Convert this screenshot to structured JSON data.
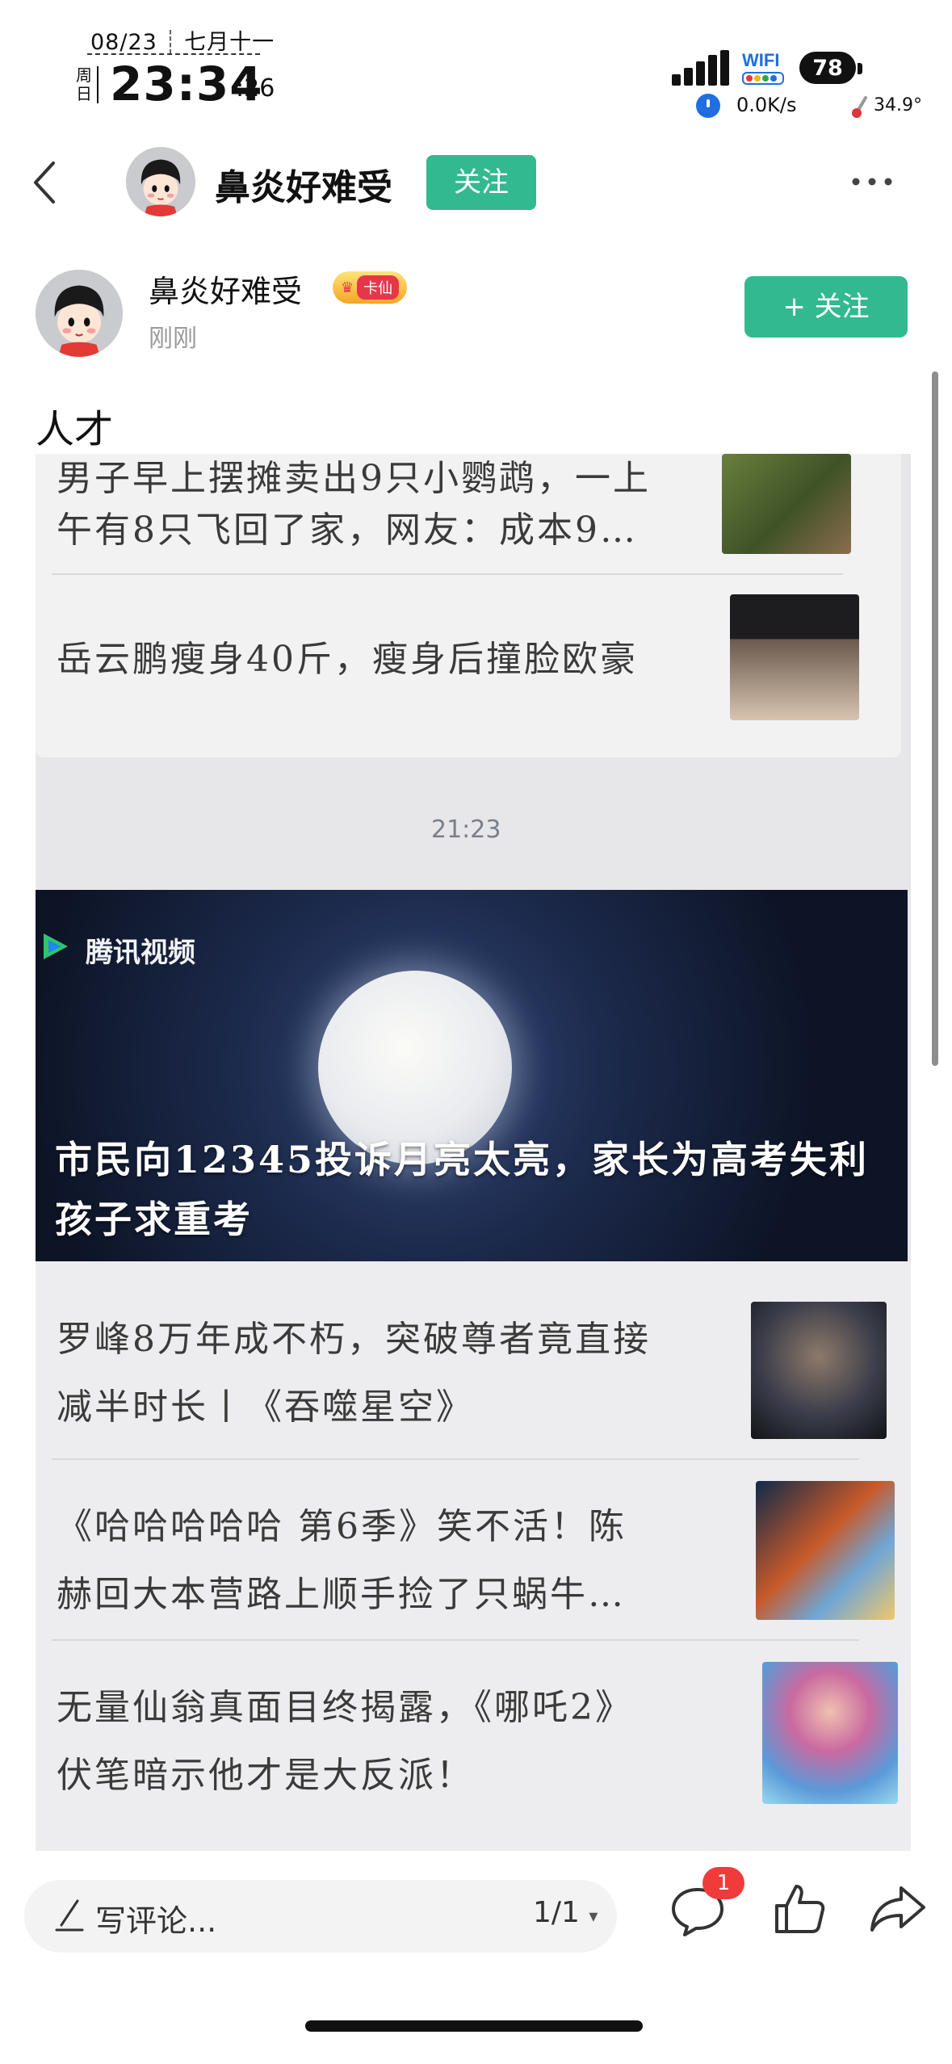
{
  "status_bar": {
    "date": "08/23",
    "lunar_date": "七月十一",
    "weekday": "周日",
    "time": "23:34",
    "seconds": ":26",
    "wifi_label": "WIFI",
    "battery": "78",
    "net_speed": "0.0K/s",
    "temperature": "34.9°"
  },
  "header": {
    "author_name": "鼻炎好难受",
    "follow_label": "关注"
  },
  "post": {
    "author_name": "鼻炎好难受",
    "badge_label": "卡仙",
    "time_label": "刚刚",
    "follow_label": "+ 关注",
    "text": "人才"
  },
  "photo": {
    "item1_line1": "男子早上摆摊卖出9只小鹦鹉，一上",
    "item1_line2": "午有8只飞回了家，网友：成本9…",
    "item2_line1": "岳云鹏瘦身40斤，瘦身后撞脸欧豪",
    "chat_time": "21:23",
    "video_source": "腾讯视频",
    "video_title_line1": "市民向12345投诉月亮太亮，家长为高考失利",
    "video_title_line2": "孩子求重考",
    "item3_line1": "罗峰8万年成不朽，突破尊者竟直接",
    "item3_line2": "减半时长丨《吞噬星空》",
    "item4_line1": "《哈哈哈哈哈 第6季》笑不活！陈",
    "item4_line2": "赫回大本营路上顺手捡了只蜗牛…",
    "item5_line1": "无量仙翁真面目终揭露，《哪吒2》",
    "item5_line2": "伏笔暗示他才是大反派！"
  },
  "bottom_bar": {
    "comment_placeholder": "写评论...",
    "page_indicator": "1/1",
    "comment_count": "1"
  },
  "colors": {
    "accent_green": "#33b98f",
    "badge_red": "#f03b3b",
    "status_blue": "#1f6fe0"
  },
  "icons": [
    "back-icon",
    "more-icon",
    "pen-icon",
    "dropdown-icon",
    "comment-icon",
    "like-icon",
    "share-icon",
    "alarm-icon",
    "thermometer-icon",
    "signal-icon",
    "tencent-video-logo-icon"
  ]
}
